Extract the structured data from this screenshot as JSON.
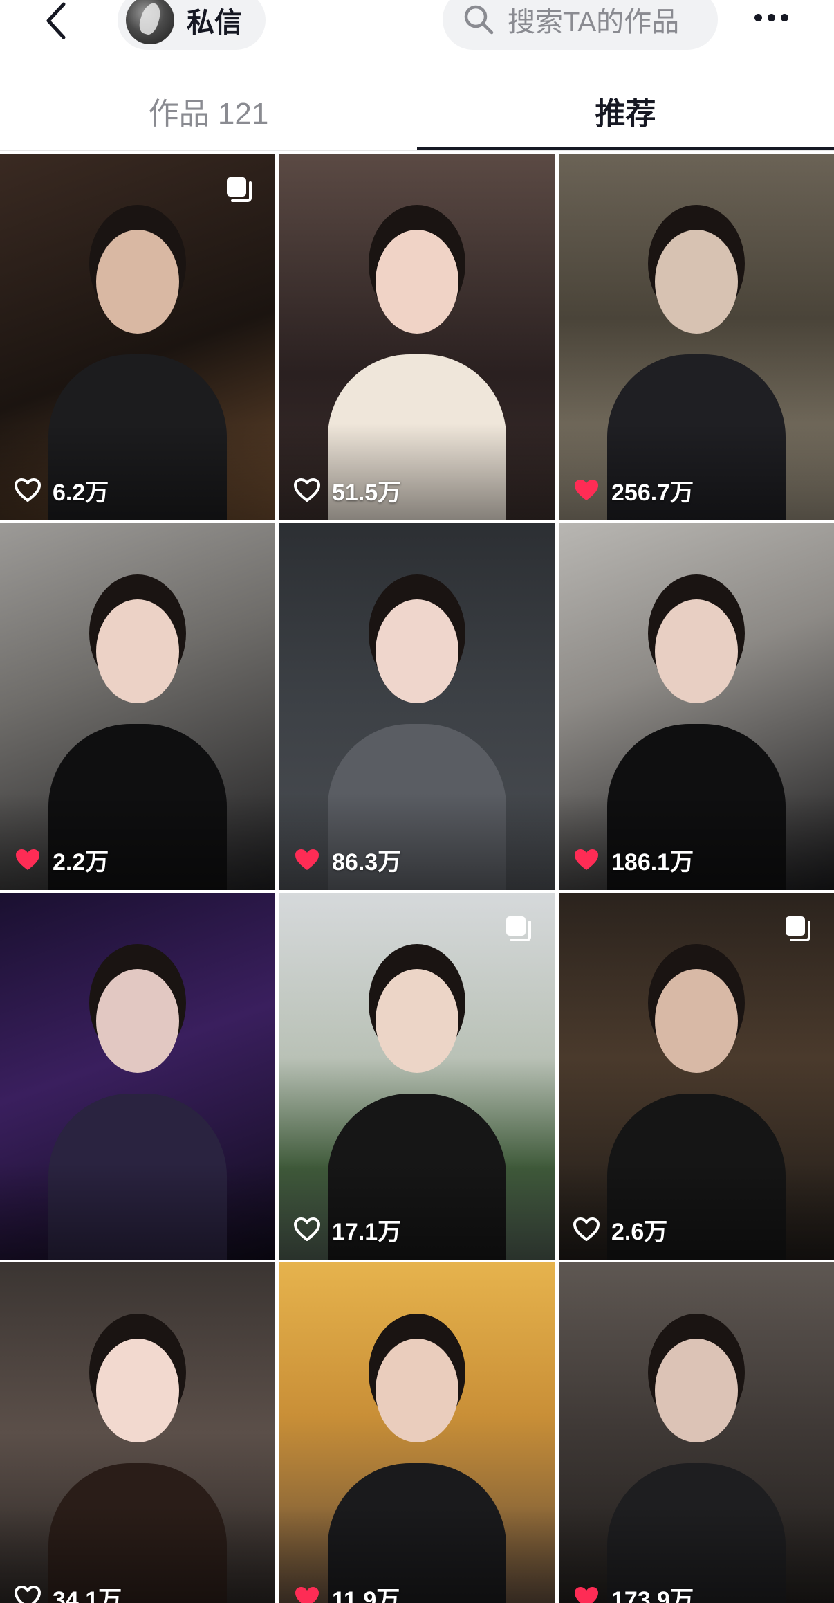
{
  "header": {
    "message_label": "私信",
    "search_placeholder": "搜索TA的作品"
  },
  "tabs": [
    {
      "label": "作品 121",
      "active": false
    },
    {
      "label": "推荐",
      "active": true
    }
  ],
  "colors": {
    "liked_heart": "#fe2c55",
    "text_primary": "#161823",
    "text_secondary": "#8a8b91",
    "chip_bg": "#f1f2f4"
  },
  "grid": {
    "items": [
      {
        "likes": "6.2万",
        "liked": false,
        "multi_image": true
      },
      {
        "likes": "51.5万",
        "liked": false,
        "multi_image": false
      },
      {
        "likes": "256.7万",
        "liked": true,
        "multi_image": false
      },
      {
        "likes": "2.2万",
        "liked": true,
        "multi_image": false
      },
      {
        "likes": "86.3万",
        "liked": true,
        "multi_image": false
      },
      {
        "likes": "186.1万",
        "liked": true,
        "multi_image": false
      },
      {
        "likes": "",
        "liked": false,
        "multi_image": false
      },
      {
        "likes": "17.1万",
        "liked": false,
        "multi_image": true
      },
      {
        "likes": "2.6万",
        "liked": false,
        "multi_image": true
      },
      {
        "likes": "34.1万",
        "liked": false,
        "multi_image": false
      },
      {
        "likes": "11.9万",
        "liked": true,
        "multi_image": false
      },
      {
        "likes": "173.9万",
        "liked": true,
        "multi_image": false
      }
    ]
  }
}
